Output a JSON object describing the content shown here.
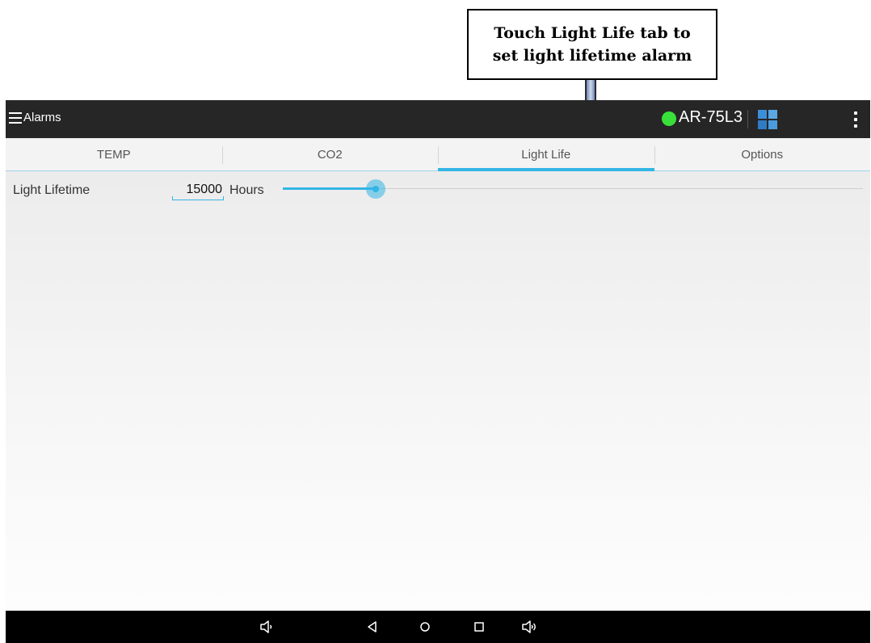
{
  "callout": {
    "line1": "Touch Light Life tab to",
    "line2": "set light lifetime alarm"
  },
  "actionbar": {
    "menu_icon": "hamburger-menu-icon",
    "title": "Alarms",
    "status_color": "#39e03a",
    "device_name": "AR-75L3",
    "app_icon": "grid-logo-icon",
    "overflow_icon": "overflow-menu-icon"
  },
  "tabs": [
    {
      "label": "TEMP",
      "active": false
    },
    {
      "label": "CO2",
      "active": false
    },
    {
      "label": "Light Life",
      "active": true
    },
    {
      "label": "Options",
      "active": false
    }
  ],
  "light_lifetime": {
    "label": "Light Lifetime",
    "value": "15000",
    "unit": "Hours",
    "slider_fraction": 0.16
  },
  "navbar": {
    "buttons": [
      "volume-down-icon",
      "back-icon",
      "home-icon",
      "recents-icon",
      "volume-up-icon"
    ]
  },
  "colors": {
    "accent": "#33b5e5",
    "actionbar_bg": "#262626",
    "status_ok": "#39e03a"
  }
}
